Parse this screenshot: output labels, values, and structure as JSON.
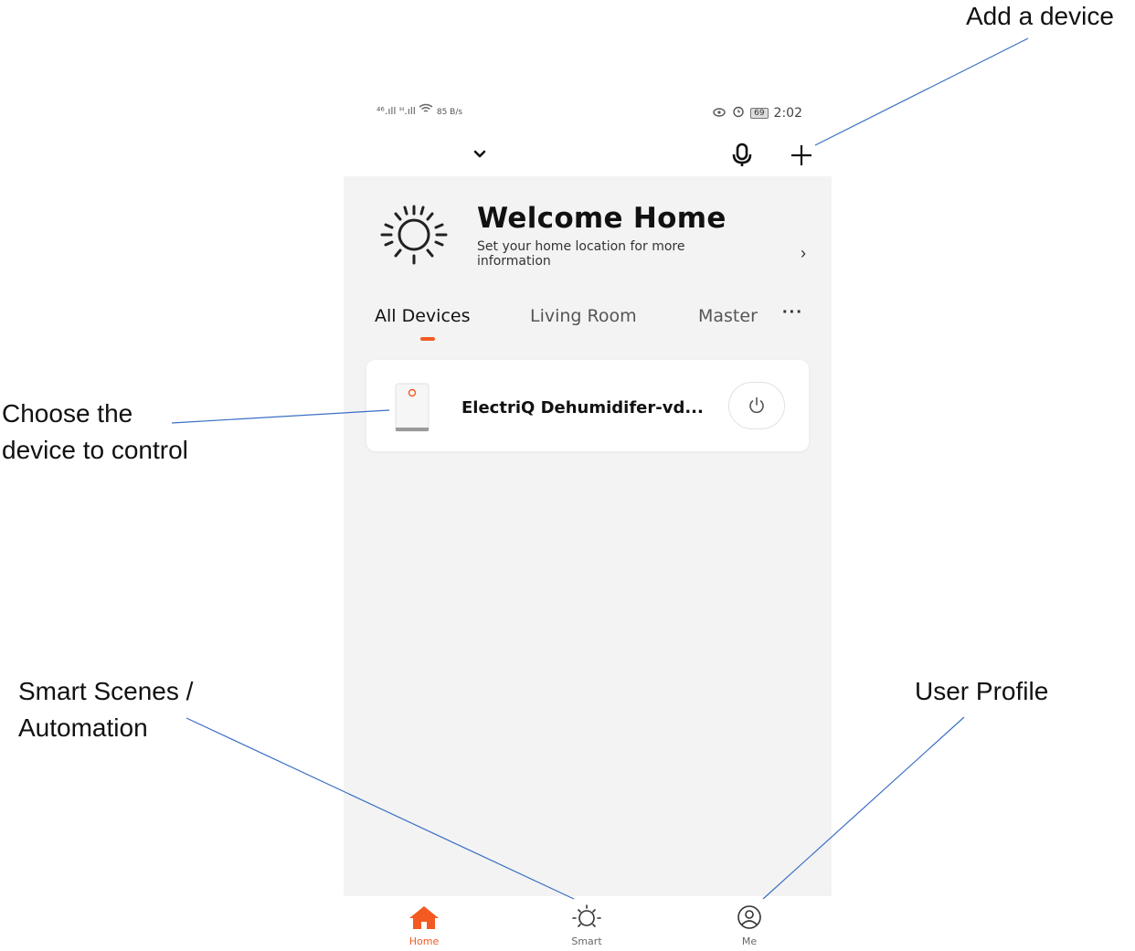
{
  "annotations": {
    "add_device": "Add a device",
    "choose_device_line1": "Choose the",
    "choose_device_line2": "device to control",
    "smart_line1": "Smart Scenes /",
    "smart_line2": "Automation",
    "profile": "User Profile"
  },
  "status_bar": {
    "signal_text": "⁴⁶.ıll ᴴ.ıll",
    "net_speed": "85 B/s",
    "battery": "69",
    "time": "2:02"
  },
  "welcome": {
    "title": "Welcome Home",
    "subtitle": "Set your home location for more information",
    "chevron": "›"
  },
  "tabs": [
    "All Devices",
    "Living Room",
    "Master"
  ],
  "tabs_more": "···",
  "devices": [
    {
      "name": "ElectriQ Dehumidifer-vd..."
    }
  ],
  "bottom_nav": [
    {
      "label": "Home",
      "icon": "home-icon",
      "active": true
    },
    {
      "label": "Smart",
      "icon": "sun-icon",
      "active": false
    },
    {
      "label": "Me",
      "icon": "user-icon",
      "active": false
    }
  ],
  "colors": {
    "accent": "#f25a22",
    "background": "#f3f3f3",
    "callout_line": "#3a6fc4"
  }
}
